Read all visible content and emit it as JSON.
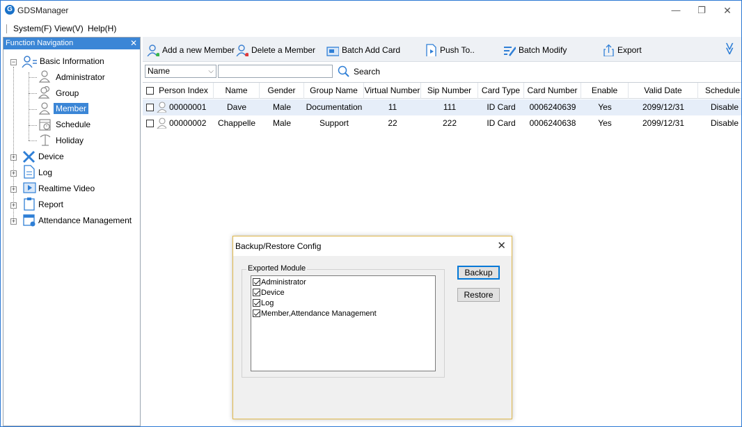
{
  "app": {
    "title": "GDSManager",
    "icon_text": "G",
    "icon": "app-logo-icon"
  },
  "window_controls": {
    "minimize": "—",
    "restore": "❐",
    "close": "✕"
  },
  "menu": {
    "items": [
      "System(F)",
      "View(V)",
      "Help(H)"
    ]
  },
  "nav": {
    "header": "Function Navigation",
    "close": "✕",
    "groups": [
      {
        "label": "Basic Information",
        "icon": "basic-info-icon",
        "expanded": true,
        "children": [
          {
            "label": "Administrator",
            "icon": "administrator-icon"
          },
          {
            "label": "Group",
            "icon": "group-icon"
          },
          {
            "label": "Member",
            "icon": "member-icon",
            "selected": true
          },
          {
            "label": "Schedule",
            "icon": "schedule-icon"
          },
          {
            "label": "Holiday",
            "icon": "holiday-icon"
          }
        ]
      },
      {
        "label": "Device",
        "icon": "device-icon"
      },
      {
        "label": "Log",
        "icon": "log-icon"
      },
      {
        "label": "Realtime Video",
        "icon": "video-icon"
      },
      {
        "label": "Report",
        "icon": "report-icon"
      },
      {
        "label": "Attendance Management",
        "icon": "attendance-icon"
      }
    ]
  },
  "toolbar": {
    "add": "Add a new Member",
    "delete": "Delete a Member",
    "batch_add": "Batch Add Card",
    "push": "Push To..",
    "batch_modify": "Batch Modify",
    "export": "Export",
    "expand": "≫"
  },
  "search": {
    "filter": "Name",
    "value": "",
    "button": "Search"
  },
  "table": {
    "columns": [
      "Person Index",
      "Name",
      "Gender",
      "Group Name",
      "Virtual Number",
      "Sip Number",
      "Card Type",
      "Card Number",
      "Enable",
      "Valid Date",
      "Schedule"
    ],
    "rows": [
      [
        "00000001",
        "Dave",
        "Male",
        "Documentation",
        "11",
        "111",
        "ID Card",
        "0006240639",
        "Yes",
        "2099/12/31",
        "Disable"
      ],
      [
        "00000002",
        "Chappelle",
        "Male",
        "Support",
        "22",
        "222",
        "ID Card",
        "0006240638",
        "Yes",
        "2099/12/31",
        "Disable"
      ]
    ]
  },
  "dialog": {
    "title": "Backup/Restore Config",
    "close": "✕",
    "group_label": "Exported Module",
    "modules": [
      "Administrator",
      "Device",
      "Log",
      "Member,Attendance Management"
    ],
    "backup": "Backup",
    "restore": "Restore"
  },
  "colors": {
    "accent": "#3b86d6",
    "selected_row": "#e6eef9",
    "dialog_border": "#e0b84a"
  }
}
